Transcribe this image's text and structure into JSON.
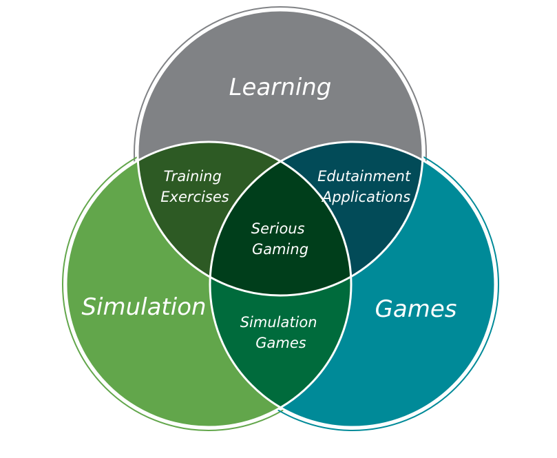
{
  "diagram": {
    "sets": [
      {
        "id": "learning",
        "label": "Learning",
        "color": "#808285"
      },
      {
        "id": "simulation",
        "label": "Simulation",
        "color": "#62a64b"
      },
      {
        "id": "games",
        "label": "Games",
        "color": "#008a98"
      }
    ],
    "intersections": [
      {
        "id": "learning-simulation",
        "lines": [
          "Training",
          "Exercises"
        ],
        "color": "#2d5a24"
      },
      {
        "id": "learning-games",
        "lines": [
          "Edutainment",
          "Applications"
        ],
        "color": "#024b58"
      },
      {
        "id": "simulation-games",
        "lines": [
          "Simulation",
          "Games"
        ],
        "color": "#006b3c"
      },
      {
        "id": "all-three",
        "lines": [
          "Serious",
          "Gaming"
        ],
        "color": "#003e1b"
      }
    ],
    "outline_color": "#ffffff"
  }
}
